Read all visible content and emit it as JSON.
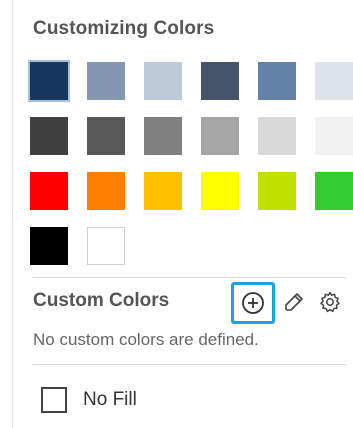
{
  "panel": {
    "title": "Customizing Colors",
    "palette_rows": [
      [
        "#17375e",
        "#8497b0",
        "#bdc9d7",
        "#44546a",
        "#6482a8",
        "#dee3ea"
      ],
      [
        "#404040",
        "#595959",
        "#808080",
        "#a6a6a6",
        "#d9d9d9",
        "#f2f2f2"
      ],
      [
        "#ff0000",
        "#ff8000",
        "#ffc000",
        "#ffff00",
        "#c0e000",
        "#33cc33"
      ],
      [
        "#000000",
        "#ffffff"
      ]
    ],
    "selected_swatch": "#17375e"
  },
  "custom_colors": {
    "label": "Custom Colors",
    "empty_message": "No custom colors are defined.",
    "add_icon": "plus-circle-icon",
    "eyedropper_icon": "eyedropper-icon",
    "settings_icon": "gear-icon",
    "highlight_color": "#1aa3dd"
  },
  "no_fill": {
    "label": "No Fill"
  }
}
